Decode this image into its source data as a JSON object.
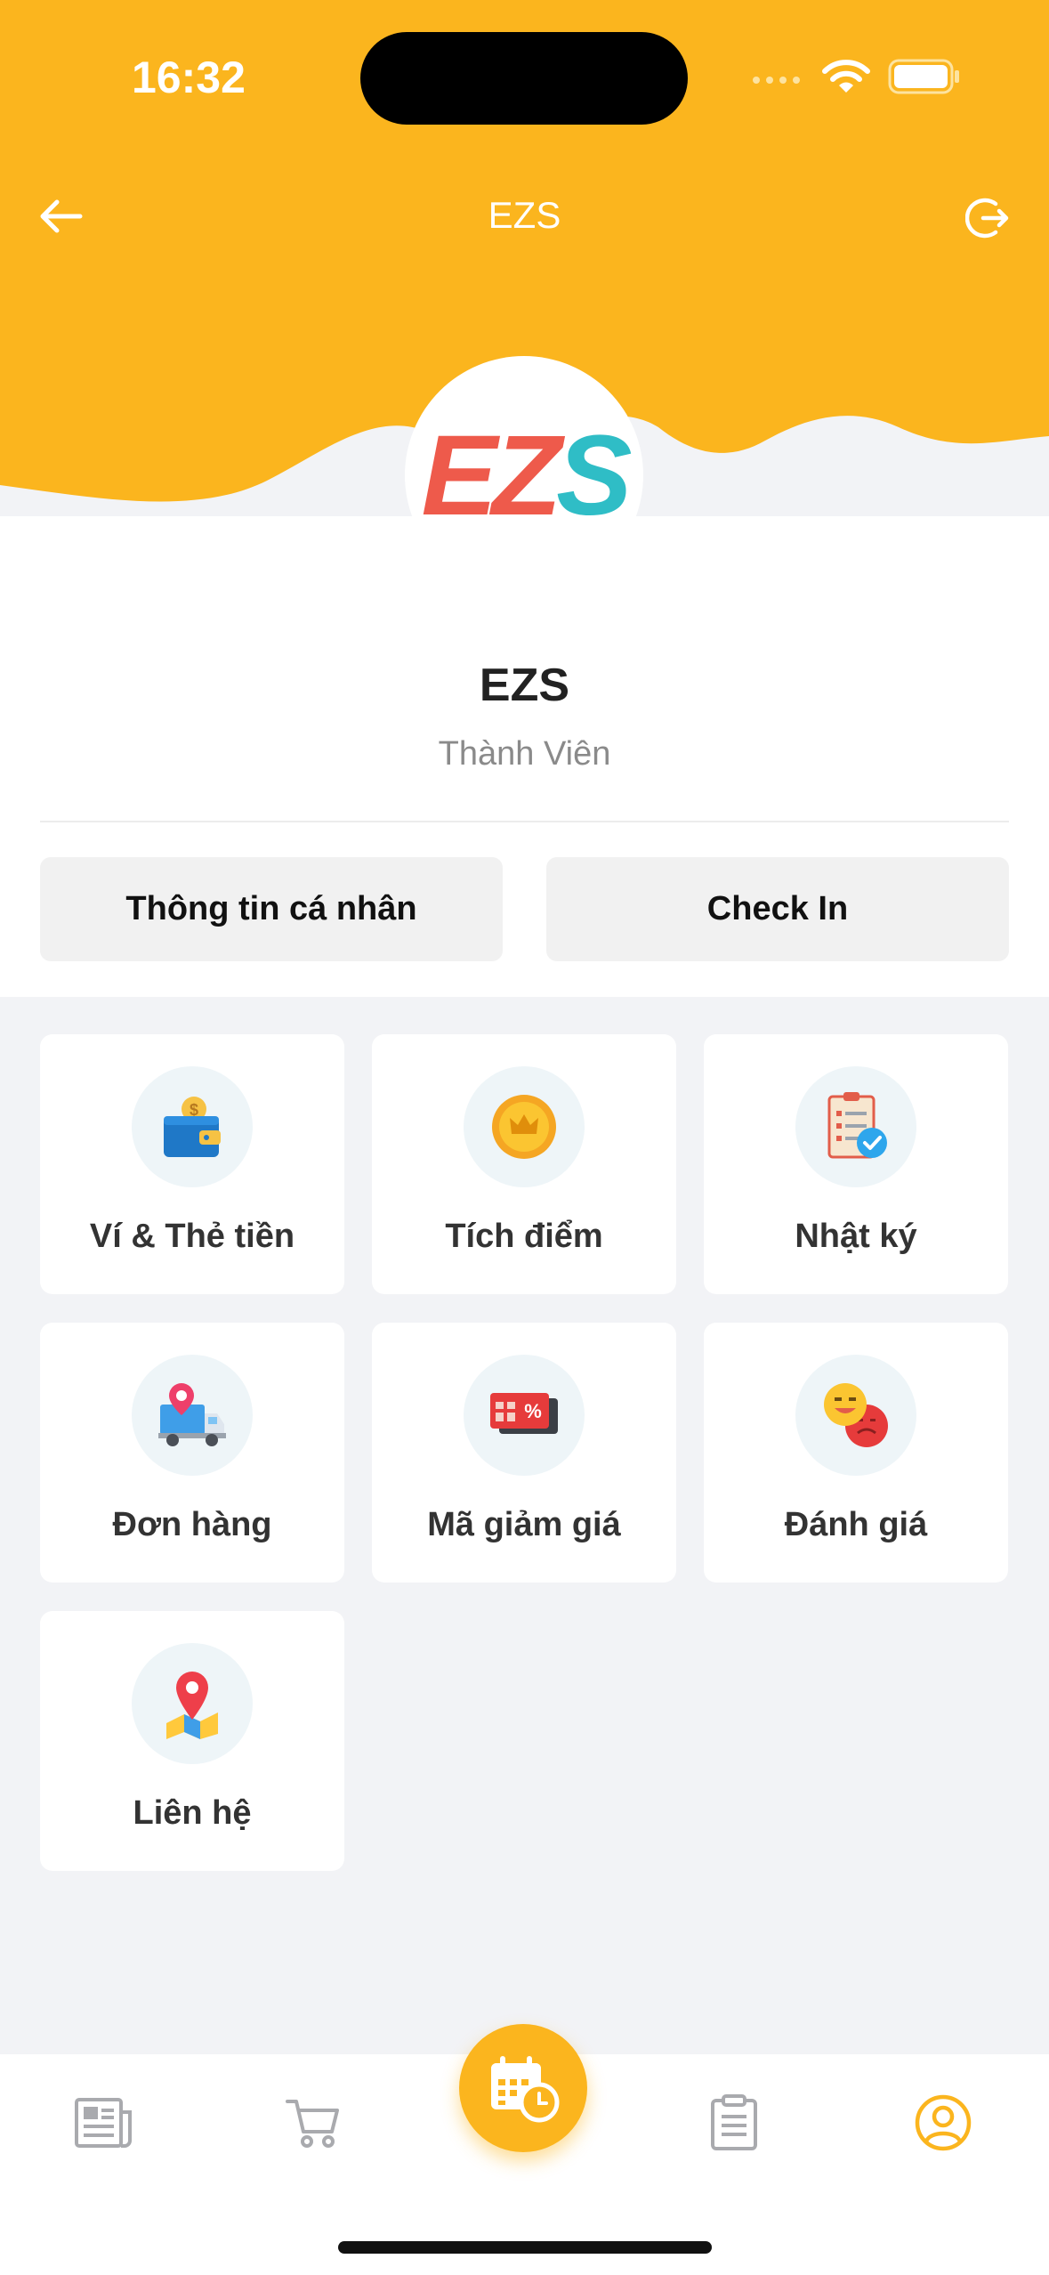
{
  "status_bar": {
    "time": "16:32"
  },
  "header": {
    "title": "EZS",
    "background_color": "#fbb51e"
  },
  "logo": {
    "text_part1": "EZ",
    "text_part2": "S"
  },
  "profile": {
    "name": "EZS",
    "role": "Thành Viên"
  },
  "actions": {
    "personal_info": "Thông tin cá nhân",
    "check_in": "Check In"
  },
  "menu": {
    "items": [
      {
        "label": "Ví & Thẻ tiền",
        "icon": "wallet-icon"
      },
      {
        "label": "Tích điểm",
        "icon": "crown-coin-icon"
      },
      {
        "label": "Nhật ký",
        "icon": "checklist-icon"
      },
      {
        "label": "Đơn hàng",
        "icon": "delivery-truck-icon"
      },
      {
        "label": "Mã giảm giá",
        "icon": "voucher-icon"
      },
      {
        "label": "Đánh giá",
        "icon": "emoji-faces-icon"
      },
      {
        "label": "Liên hệ",
        "icon": "location-pin-icon"
      }
    ]
  },
  "bottom_nav": {
    "items": [
      {
        "icon": "news-icon"
      },
      {
        "icon": "cart-icon"
      },
      {
        "icon": "calendar-clock-icon"
      },
      {
        "icon": "clipboard-icon"
      },
      {
        "icon": "profile-icon",
        "active": true
      }
    ],
    "accent": "#fbb51e",
    "inactive": "#a9aaae"
  }
}
